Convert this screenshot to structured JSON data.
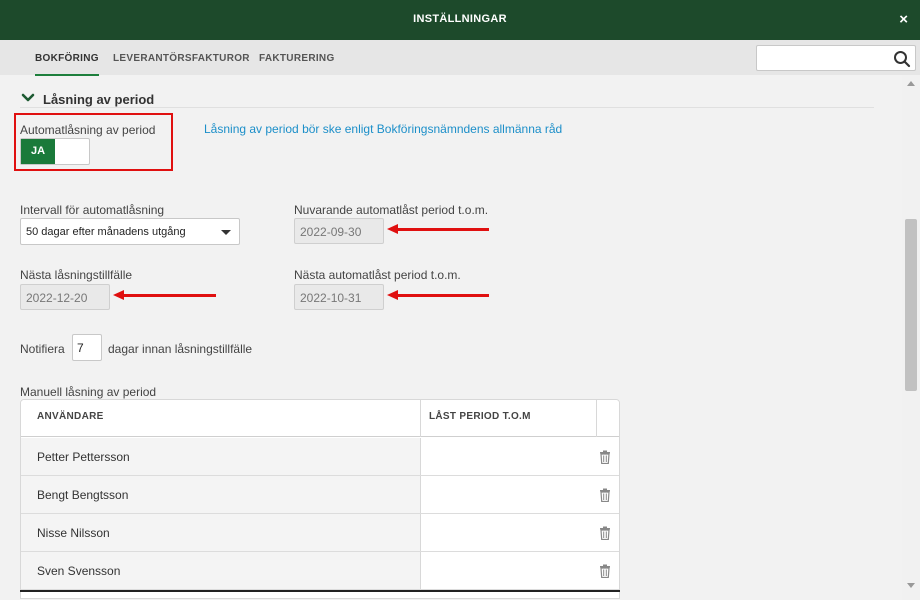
{
  "window": {
    "title": "INSTÄLLNINGAR",
    "close_glyph": "×"
  },
  "tabs": [
    {
      "label": "BOKFÖRING",
      "active": true
    },
    {
      "label": "LEVERANTÖRSFAKTUROR",
      "active": false
    },
    {
      "label": "FAKTURERING",
      "active": false
    }
  ],
  "search": {
    "value": "",
    "placeholder": "",
    "icon": "search-icon"
  },
  "section": {
    "title": "Låsning av period",
    "expanded": true,
    "icon": "chevron-down-icon"
  },
  "auto_lock": {
    "label": "Automatlåsning av period",
    "toggle_label": "JA",
    "enabled": true,
    "info_link": "Låsning av period bör ske enligt Bokföringsnämndens allmänna råd"
  },
  "interval": {
    "label": "Intervall för automatlåsning",
    "selected": "50 dagar efter månadens utgång"
  },
  "current_period": {
    "label": "Nuvarande automatlåst period t.o.m.",
    "value": "2022-09-30"
  },
  "next_lock": {
    "label": "Nästa låsningstillfälle",
    "value": "2022-12-20"
  },
  "next_period": {
    "label": "Nästa automatlåst period t.o.m.",
    "value": "2022-10-31"
  },
  "notify": {
    "prefix": "Notifiera",
    "value": "7",
    "suffix": "dagar innan låsningstillfälle"
  },
  "manual_lock": {
    "title": "Manuell låsning av period",
    "columns": [
      "ANVÄNDARE",
      "LÅST PERIOD T.O.M"
    ],
    "rows": [
      {
        "user": "Petter Pettersson",
        "period": ""
      },
      {
        "user": "Bengt Bengtsson",
        "period": ""
      },
      {
        "user": "Nisse Nilsson",
        "period": ""
      },
      {
        "user": "Sven Svensson",
        "period": ""
      }
    ],
    "row_action_icon": "trash-icon"
  },
  "annotations": {
    "highlight_color": "#e01010"
  },
  "colors": {
    "titlebar": "#1d4a2b",
    "toggle_on": "#1a7a3a",
    "link": "#1c8fc9"
  }
}
